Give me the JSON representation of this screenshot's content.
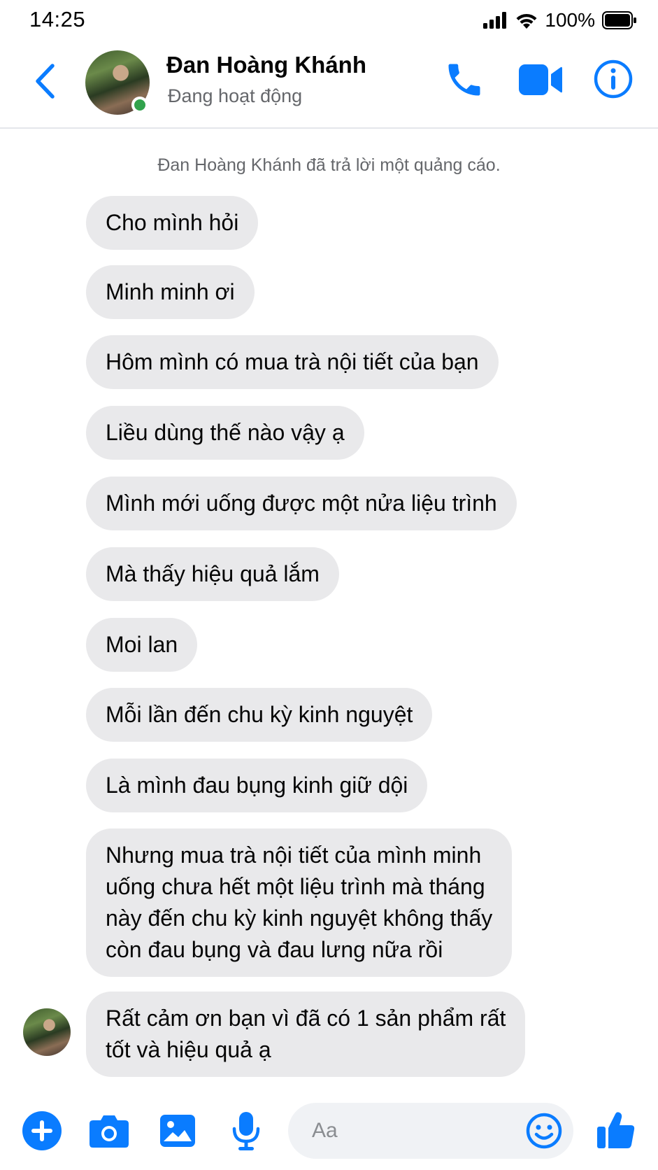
{
  "status_bar": {
    "time": "14:25",
    "battery": "100%"
  },
  "header": {
    "contact_name": "Đan Hoàng Khánh",
    "contact_status": "Đang hoạt động"
  },
  "chat": {
    "system_note": "Đan Hoàng Khánh đã trả lời một quảng cáo.",
    "messages": [
      "Cho mình hỏi",
      "Minh minh ơi",
      "Hôm mình có mua trà nội tiết của bạn",
      "Liều dùng thế nào vậy ạ",
      "Mình mới uống được một nửa liệu trình",
      "Mà thấy hiệu quả lắm",
      "Moi lan",
      "Mỗi lần đến chu kỳ kinh nguyệt",
      "Là mình đau bụng kinh giữ dội",
      "Nhưng mua trà nội tiết của mình minh\nuống chưa hết một liệu trình mà tháng\nnày đến chu kỳ kinh nguyệt không thấy\ncòn đau bụng và đau lưng nữa rồi",
      "Rất cảm ơn bạn vì đã có 1 sản phẩm rất\ntốt và hiệu quả ạ"
    ]
  },
  "composer": {
    "placeholder": "Aa"
  },
  "icons": {
    "back": "chevron-left-icon",
    "call": "phone-icon",
    "video": "video-camera-icon",
    "info": "info-icon",
    "add": "plus-circle-icon",
    "camera": "camera-icon",
    "gallery": "image-icon",
    "voice": "microphone-icon",
    "emoji": "smiley-icon",
    "like": "thumbs-up-icon"
  },
  "colors": {
    "accent": "#0a7cff",
    "bubble": "#e9e9eb",
    "online": "#31a24c"
  }
}
